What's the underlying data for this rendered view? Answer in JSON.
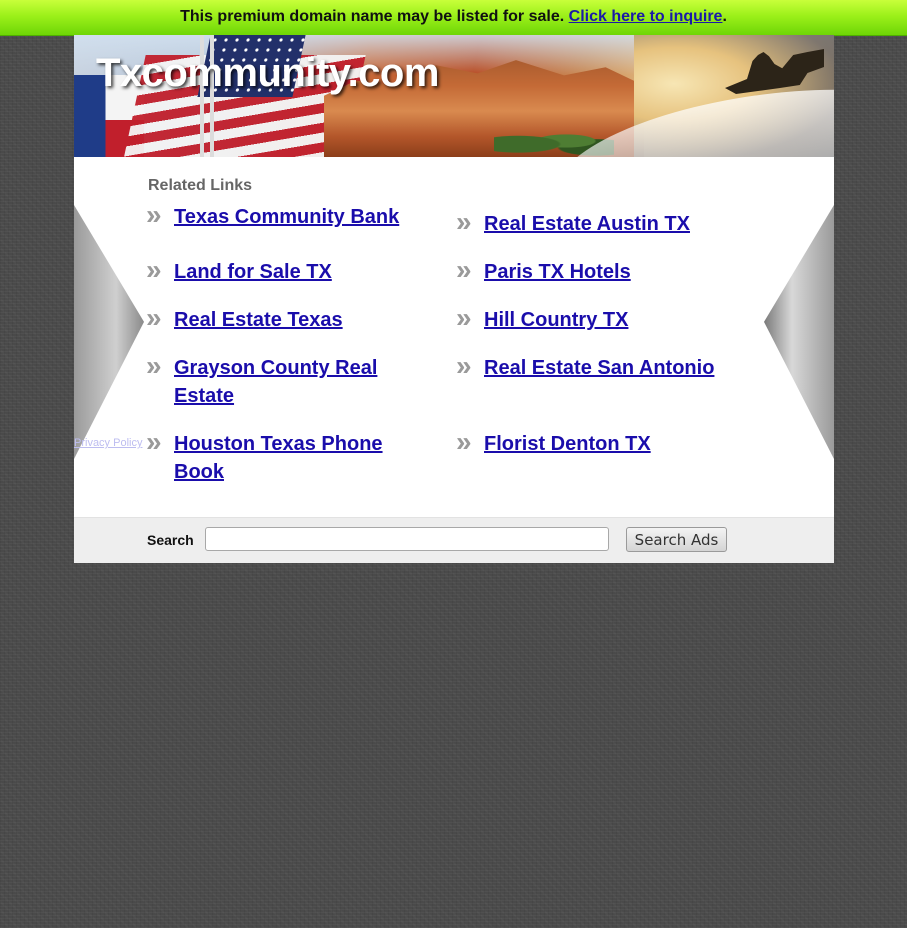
{
  "sale_banner": {
    "text": "This premium domain name may be listed for sale.",
    "link_label": "Click here to inquire",
    "suffix": "."
  },
  "header": {
    "site_title": "Txcommunity.com"
  },
  "related": {
    "heading": "Related Links",
    "links": [
      {
        "label": "Texas Community Bank"
      },
      {
        "label": "Real Estate Austin TX"
      },
      {
        "label": "Land for Sale TX"
      },
      {
        "label": "Paris TX Hotels"
      },
      {
        "label": "Real Estate Texas"
      },
      {
        "label": "Hill Country TX"
      },
      {
        "label": "Grayson County Real Estate"
      },
      {
        "label": "Real Estate San Antonio"
      },
      {
        "label": "Houston Texas Phone Book"
      },
      {
        "label": "Florist Denton TX"
      }
    ],
    "bullet_icon": "double-chevron-right-icon"
  },
  "search": {
    "label": "Search",
    "input_value": "",
    "button_label": "Search Ads"
  },
  "footer": {
    "privacy_label": "Privacy Policy"
  },
  "colors": {
    "banner_green": "#9cf01a",
    "link_blue": "#1a0dab",
    "background_gray": "#4a4a4a"
  }
}
